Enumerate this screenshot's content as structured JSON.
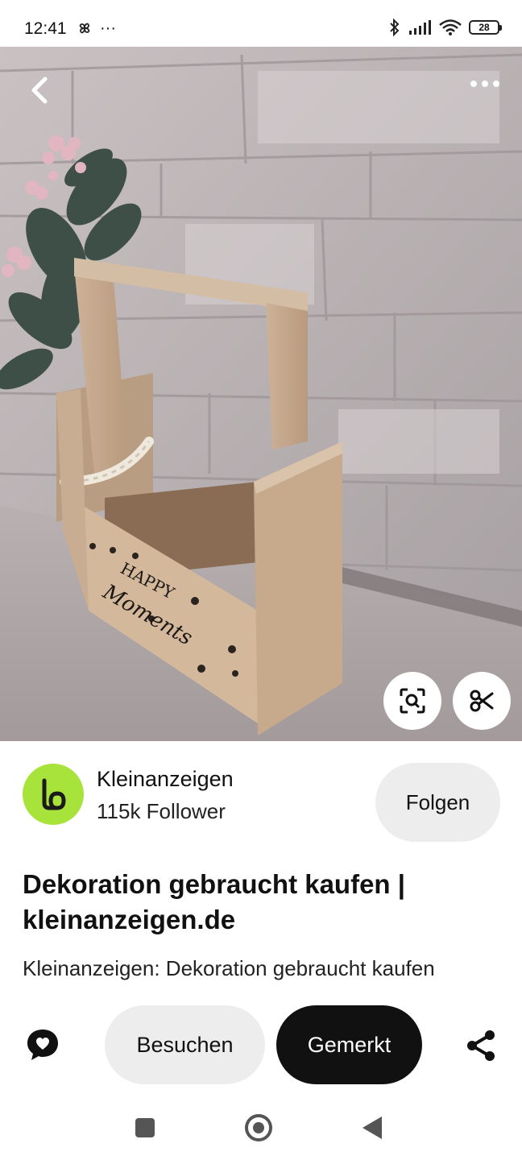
{
  "status_bar": {
    "time": "12:41",
    "dots": "···",
    "battery": "28",
    "icons": [
      "pinwheel-icon",
      "bluetooth-icon",
      "signal-icon",
      "wifi-icon",
      "battery-icon"
    ]
  },
  "hero": {
    "image_description_icons": [
      "back-arrow-icon",
      "more-dots-icon",
      "visual-search-icon",
      "scissors-icon"
    ],
    "box_lettering": "HAPPY Moments"
  },
  "creator": {
    "name": "Kleinanzeigen",
    "followers": "115k Follower",
    "follow_label": "Folgen",
    "avatar_color": "#a8e33b"
  },
  "pin": {
    "title": "Dekoration gebraucht kaufen | kleinanzeigen.de",
    "description": "Kleinanzeigen: Dekoration gebraucht kaufen"
  },
  "actions": {
    "visit_label": "Besuchen",
    "saved_label": "Gemerkt",
    "icons": [
      "comment-icon",
      "share-icon"
    ]
  },
  "colors": {
    "primary_button": "#111111",
    "secondary_button": "#ededed"
  }
}
